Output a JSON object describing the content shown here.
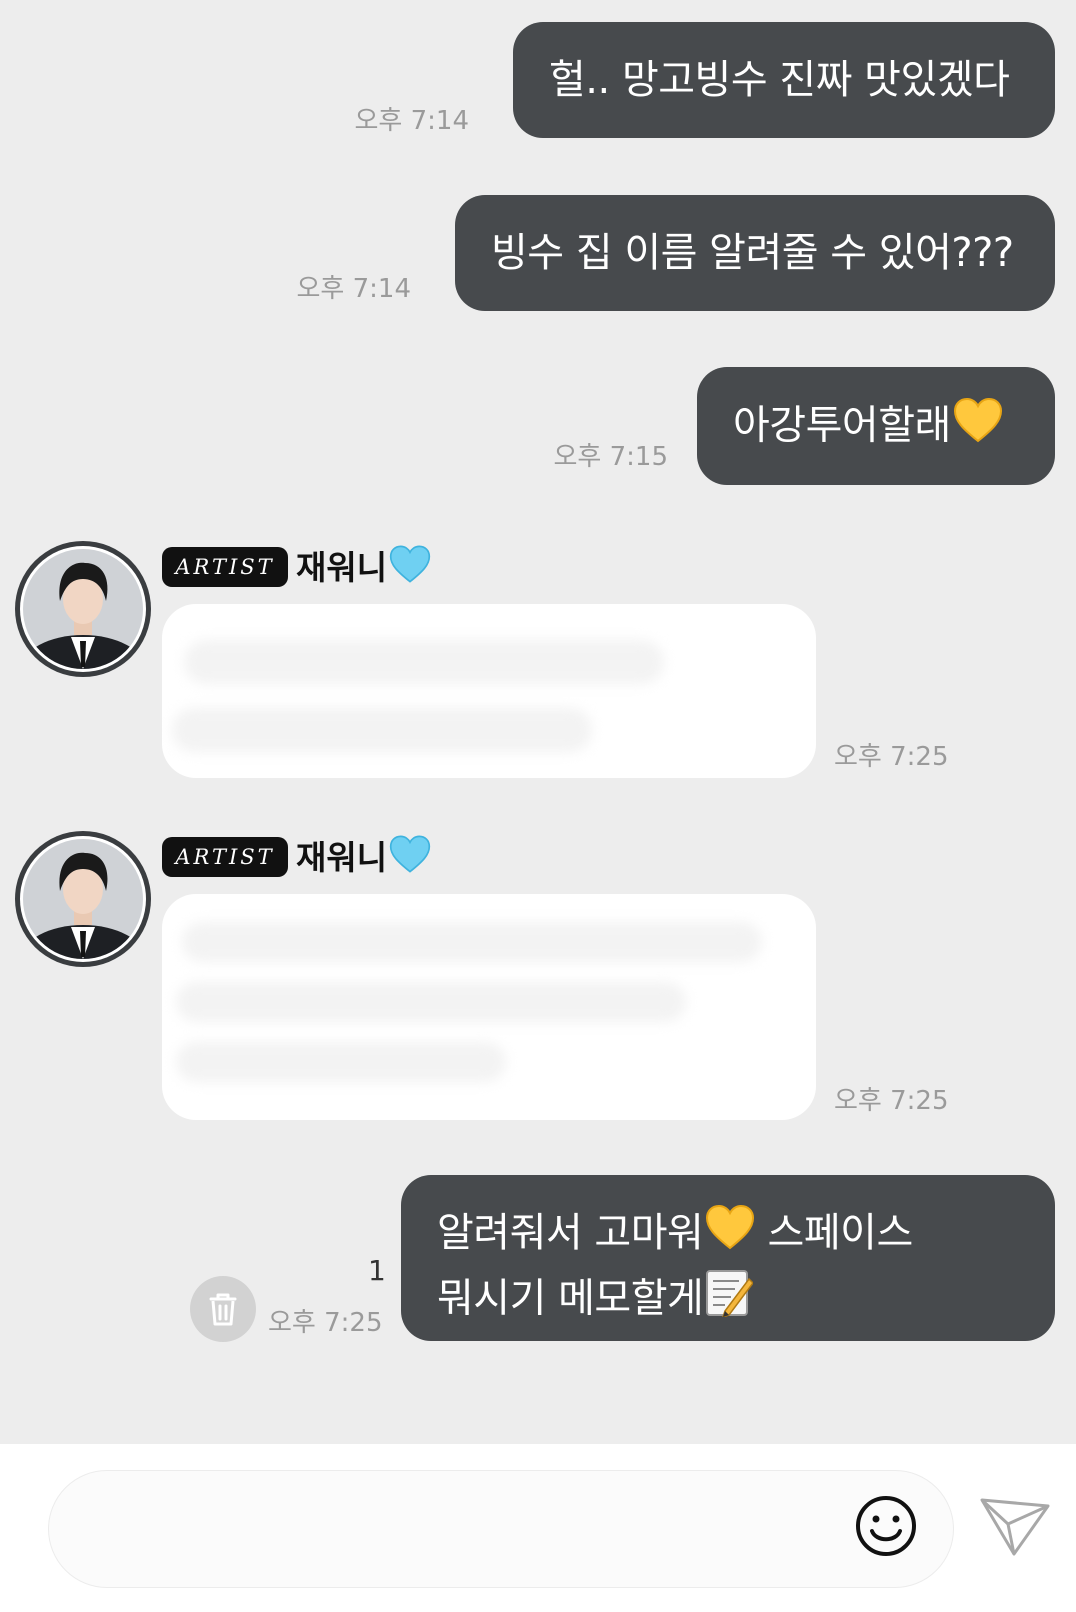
{
  "messages_out": [
    {
      "text": "헐.. 망고빙수 진짜 맛있겠다",
      "time": "오후 7:14"
    },
    {
      "text": "빙수 집 이름 알려줄 수 있어???",
      "time": "오후 7:14"
    },
    {
      "text": "아강투어할래",
      "time": "오후 7:15",
      "emoji": "yellow-heart"
    },
    {
      "line1": "알려줘서 고마워",
      "line1_after": " 스페이스",
      "line2": "뭐시기 메모할게",
      "time": "오후 7:25",
      "unread": "1",
      "emoji1": "yellow-heart",
      "emoji2": "memo"
    }
  ],
  "messages_in": [
    {
      "badge": "ARTIST",
      "name": "재워니",
      "name_emoji": "blue-heart",
      "time": "오후 7:25"
    },
    {
      "badge": "ARTIST",
      "name": "재워니",
      "name_emoji": "blue-heart",
      "time": "오후 7:25"
    }
  ],
  "input": {
    "placeholder": ""
  },
  "colors": {
    "background": "#ededed",
    "bubble_out": "#474a4d",
    "bubble_in": "#ffffff",
    "timestamp": "#9a9a9a",
    "badge": "#111111",
    "yellow_heart": "#ffc83d",
    "blue_heart": "#6fd0f2"
  }
}
